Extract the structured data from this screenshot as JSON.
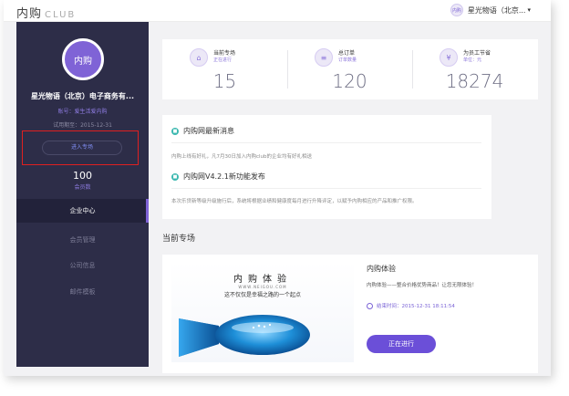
{
  "header": {
    "logo": "内购",
    "logo_suffix": "CLUB",
    "user_name": "星光物语（北京...",
    "user_avatar": "内购"
  },
  "sidebar": {
    "avatar_text": "内购",
    "company": "星光物语（北京）电子商务有...",
    "account": "账号：爱生活爱内购",
    "trial": "试用期至：2015-12-31",
    "enter_button": "进入专场",
    "member_count": "100",
    "member_label": "会员数",
    "nav": [
      {
        "label": "企业中心",
        "active": true
      },
      {
        "label": "会员管理",
        "active": false
      },
      {
        "label": "公司信息",
        "active": false
      },
      {
        "label": "邮件模板",
        "active": false
      }
    ],
    "accent_color": "#7f63d6"
  },
  "stats": [
    {
      "title": "当前专场",
      "sub": "正在进行",
      "value": "15",
      "icon": "tag-icon"
    },
    {
      "title": "总订单",
      "sub": "订单数量",
      "value": "120",
      "icon": "order-icon"
    },
    {
      "title": "为员工节省",
      "sub": "单位：元",
      "value": "18274",
      "icon": "savings-icon"
    }
  ],
  "news": [
    {
      "title": "内购网最新消息",
      "text": "内购上线有好礼，凡7月30日加入内购club的企业均有好礼相送"
    },
    {
      "title": "内购网V4.2.1新功能发布",
      "text": "本次乐贷新等级升级施行后，系统将根据业绩和健康度每月进行升降评定，以赋予内购相应的产品和推广权限。"
    }
  ],
  "section_title": "当前专场",
  "activity": {
    "banner_title": "内购体验",
    "banner_url": "WWW.NEIGOU.COM",
    "banner_slogan": "这不仅仅是幸福之路的一个起点",
    "title": "内购体验",
    "desc": "内购体验——整合价格优势商品！让您无限体验！",
    "time": "结束时间：2015-12-31 18:11:54",
    "status": "正在进行"
  }
}
